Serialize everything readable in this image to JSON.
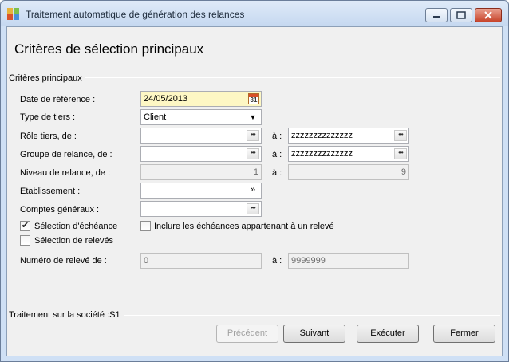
{
  "window": {
    "title": "Traitement automatique de génération des relances",
    "icon": "app-grid-icon"
  },
  "heading": "Critères de sélection principaux",
  "section": {
    "title": "Critères principaux"
  },
  "fields": {
    "date_reference": {
      "label": "Date de référence :",
      "value": "24/05/2013",
      "icon_text": "31"
    },
    "type_tiers": {
      "label": "Type de tiers :",
      "value": "Client"
    },
    "role_tiers": {
      "label": "Rôle tiers, de :",
      "from": "",
      "to_label": "à :",
      "to": "zzzzzzzzzzzzzz"
    },
    "groupe_relance": {
      "label": "Groupe de relance, de :",
      "from": "",
      "to_label": "à :",
      "to": "zzzzzzzzzzzzzz"
    },
    "niveau_relance": {
      "label": "Niveau de relance, de :",
      "from": "1",
      "to_label": "à :",
      "to": "9"
    },
    "etablissement": {
      "label": "Etablissement :",
      "value": ""
    },
    "comptes_generaux": {
      "label": "Comptes généraux :",
      "value": ""
    },
    "numero_releve": {
      "label": "Numéro de relevé de :",
      "from": "0",
      "to_label": "à :",
      "to": "9999999"
    }
  },
  "checkboxes": {
    "selection_echeance": {
      "label": "Sélection d'échéance",
      "checked": true
    },
    "inclure_echeances": {
      "label": "Inclure les échéances appartenant à un relevé",
      "checked": false
    },
    "selection_releves": {
      "label": "Sélection de relevés",
      "checked": false
    }
  },
  "footer": {
    "company_text": "Traitement sur la société :S1"
  },
  "buttons": {
    "precedent": "Précédent",
    "suivant": "Suivant",
    "executer": "Exécuter",
    "fermer": "Fermer"
  }
}
